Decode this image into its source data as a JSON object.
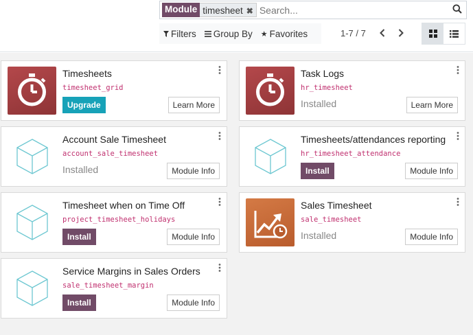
{
  "search": {
    "facet_label": "Module",
    "facet_value": "timesheet",
    "placeholder": "Search..."
  },
  "controls": {
    "filters": "Filters",
    "group_by": "Group By",
    "favorites": "Favorites"
  },
  "pager": {
    "value": "1-7 / 7"
  },
  "cards": [
    {
      "title": "Timesheets",
      "tech": "timesheet_grid",
      "primary": "Upgrade",
      "secondary": "Learn More",
      "icon": "stopwatch-icon"
    },
    {
      "title": "Task Logs",
      "tech": "hr_timesheet",
      "status": "Installed",
      "secondary": "Learn More",
      "icon": "stopwatch-icon"
    },
    {
      "title": "Account Sale Timesheet",
      "tech": "account_sale_timesheet",
      "status": "Installed",
      "secondary": "Module Info",
      "icon": "cube-icon"
    },
    {
      "title": "Timesheets/attendances reporting",
      "tech": "hr_timesheet_attendance",
      "primary": "Install",
      "secondary": "Module Info",
      "icon": "cube-icon"
    },
    {
      "title": "Timesheet when on Time Off",
      "tech": "project_timesheet_holidays",
      "primary": "Install",
      "secondary": "Module Info",
      "icon": "cube-icon"
    },
    {
      "title": "Sales Timesheet",
      "tech": "sale_timesheet",
      "status": "Installed",
      "secondary": "Module Info",
      "icon": "sales-chart-icon"
    },
    {
      "title": "Service Margins in Sales Orders",
      "tech": "sale_timesheet_margin",
      "primary": "Install",
      "secondary": "Module Info",
      "icon": "cube-icon"
    }
  ],
  "colors": {
    "brand": "#714b67",
    "upgrade": "#17a2b8",
    "timesheet_icon": "#9e3c3f",
    "sales_icon": "#c96a38",
    "cube": "#6cc7d1"
  }
}
